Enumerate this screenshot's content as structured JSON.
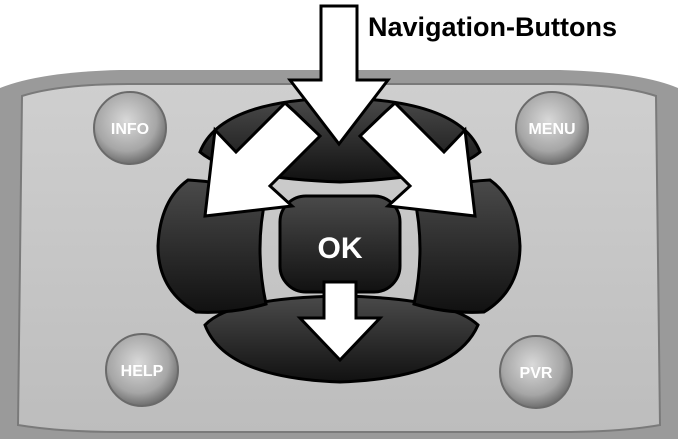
{
  "caption": {
    "text": "Navigation-Buttons"
  },
  "buttons": {
    "info": "INFO",
    "menu": "MENU",
    "help": "HELP",
    "pvr": "PVR",
    "ok": "OK"
  },
  "dpad": {
    "directions": [
      "up",
      "left",
      "right",
      "down"
    ]
  },
  "arrows": {
    "count": 4,
    "targets": [
      "up",
      "left",
      "right",
      "down"
    ]
  },
  "icons": {
    "callout_arrow": "arrow-icon"
  }
}
